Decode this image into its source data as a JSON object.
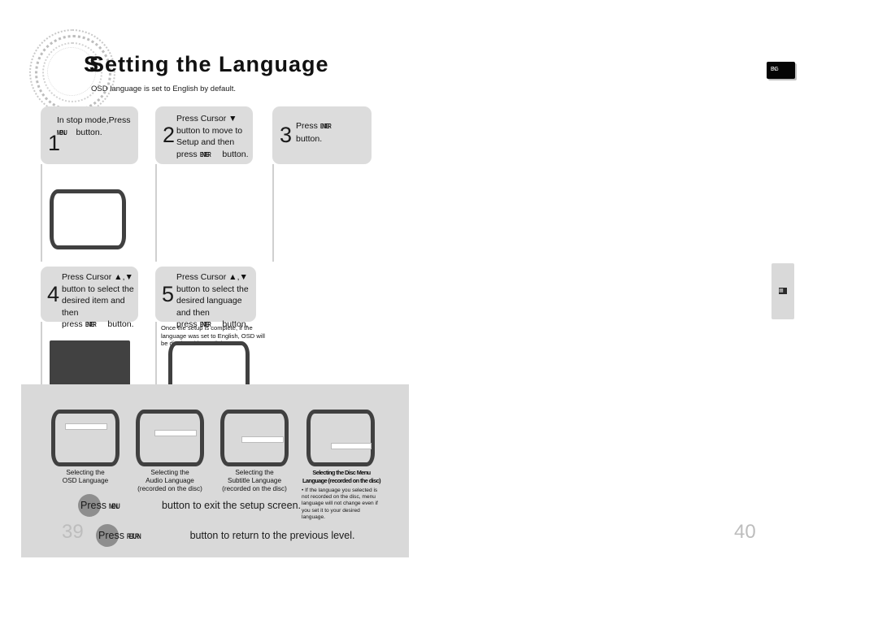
{
  "header": {
    "title_text": "Setting the Language",
    "title_overlap_glyph": "S",
    "subtitle": "OSD language is set to English by default.",
    "logo_name": "circular-ring-watermark"
  },
  "steps": [
    {
      "number": "1",
      "lines": [
        "In stop mode,Press",
        "button."
      ],
      "button_key": "MENU",
      "key_position": "line2-start"
    },
    {
      "number": "2",
      "lines": [
        "Press Cursor ▼",
        "button to move to",
        " Setup  and then",
        "press            button."
      ],
      "button_key": "ENTER",
      "key_position": "line4-inline"
    },
    {
      "number": "3",
      "lines": [
        "Press",
        "button."
      ],
      "button_key": "ENTER",
      "key_position": "line1-end"
    },
    {
      "number": "4",
      "lines": [
        "Press Cursor  ▲,▼",
        "button to select the",
        "desired item and then",
        "press            button."
      ],
      "button_key": "ENTER",
      "key_position": "line4-inline"
    },
    {
      "number": "5",
      "lines": [
        "Press Cursor  ▲,▼",
        "button to select the",
        "desired language and then",
        "press            button."
      ],
      "button_key": "ENTER",
      "key_position": "line4-inline"
    }
  ],
  "notes": {
    "step5_note": "Once the setup is complete, if the language was set to English, OSD will be displayed in English."
  },
  "screens": [
    {
      "name": "step1-tv-screen",
      "state": "blank-white"
    },
    {
      "name": "step4-tv-screen",
      "state": "filled-dark"
    },
    {
      "name": "step5-tv-screen",
      "state": "blank-white"
    }
  ],
  "bottom": {
    "thumbnails": [
      {
        "caption": "Selecting the\nOSD Language",
        "caption_lines": [
          "Selecting the",
          "OSD Language"
        ],
        "overlapped": false
      },
      {
        "caption": "Selecting the\nAudio Language\n(recorded on the disc)",
        "caption_lines": [
          "Selecting the",
          "Audio Language",
          "(recorded on the disc)"
        ],
        "overlapped": false
      },
      {
        "caption": "Selecting the\nSubtitle Language\n(recorded on the disc)",
        "caption_lines": [
          "Selecting the",
          "Subtitle Language",
          "(recorded on the disc)"
        ],
        "overlapped": false
      },
      {
        "caption": "Selecting the Disc Menu\nLanguage (recorded on the disc)",
        "caption_lines": [
          "Selecting the Disc Menu",
          "Language (recorded on the disc)"
        ],
        "overlapped": true
      }
    ],
    "bullet_note": "• If the language you selected is not recorded on the disc, menu language will not change even if you set it to your desired language.",
    "exit_line": {
      "press_word": "Press",
      "key": "MENU",
      "rest": "button to exit the setup screen."
    },
    "return_line": {
      "press_word": "Press",
      "key": "RETURN",
      "rest": "button to return to the previous level."
    }
  },
  "page_numbers": {
    "left": "39",
    "right": "40"
  },
  "tabs": {
    "dark_tab_label": "ENG",
    "light_tab_glyph": "▦"
  },
  "colors": {
    "step_box_bg": "#dcdcdc",
    "panel_bg": "#d9d9d9",
    "tv_bezel": "#404040",
    "tv_filled": "#414141",
    "badge": "#8e8e8e",
    "pagenum": "#bdbdbd",
    "dark_tab": "#050505"
  }
}
